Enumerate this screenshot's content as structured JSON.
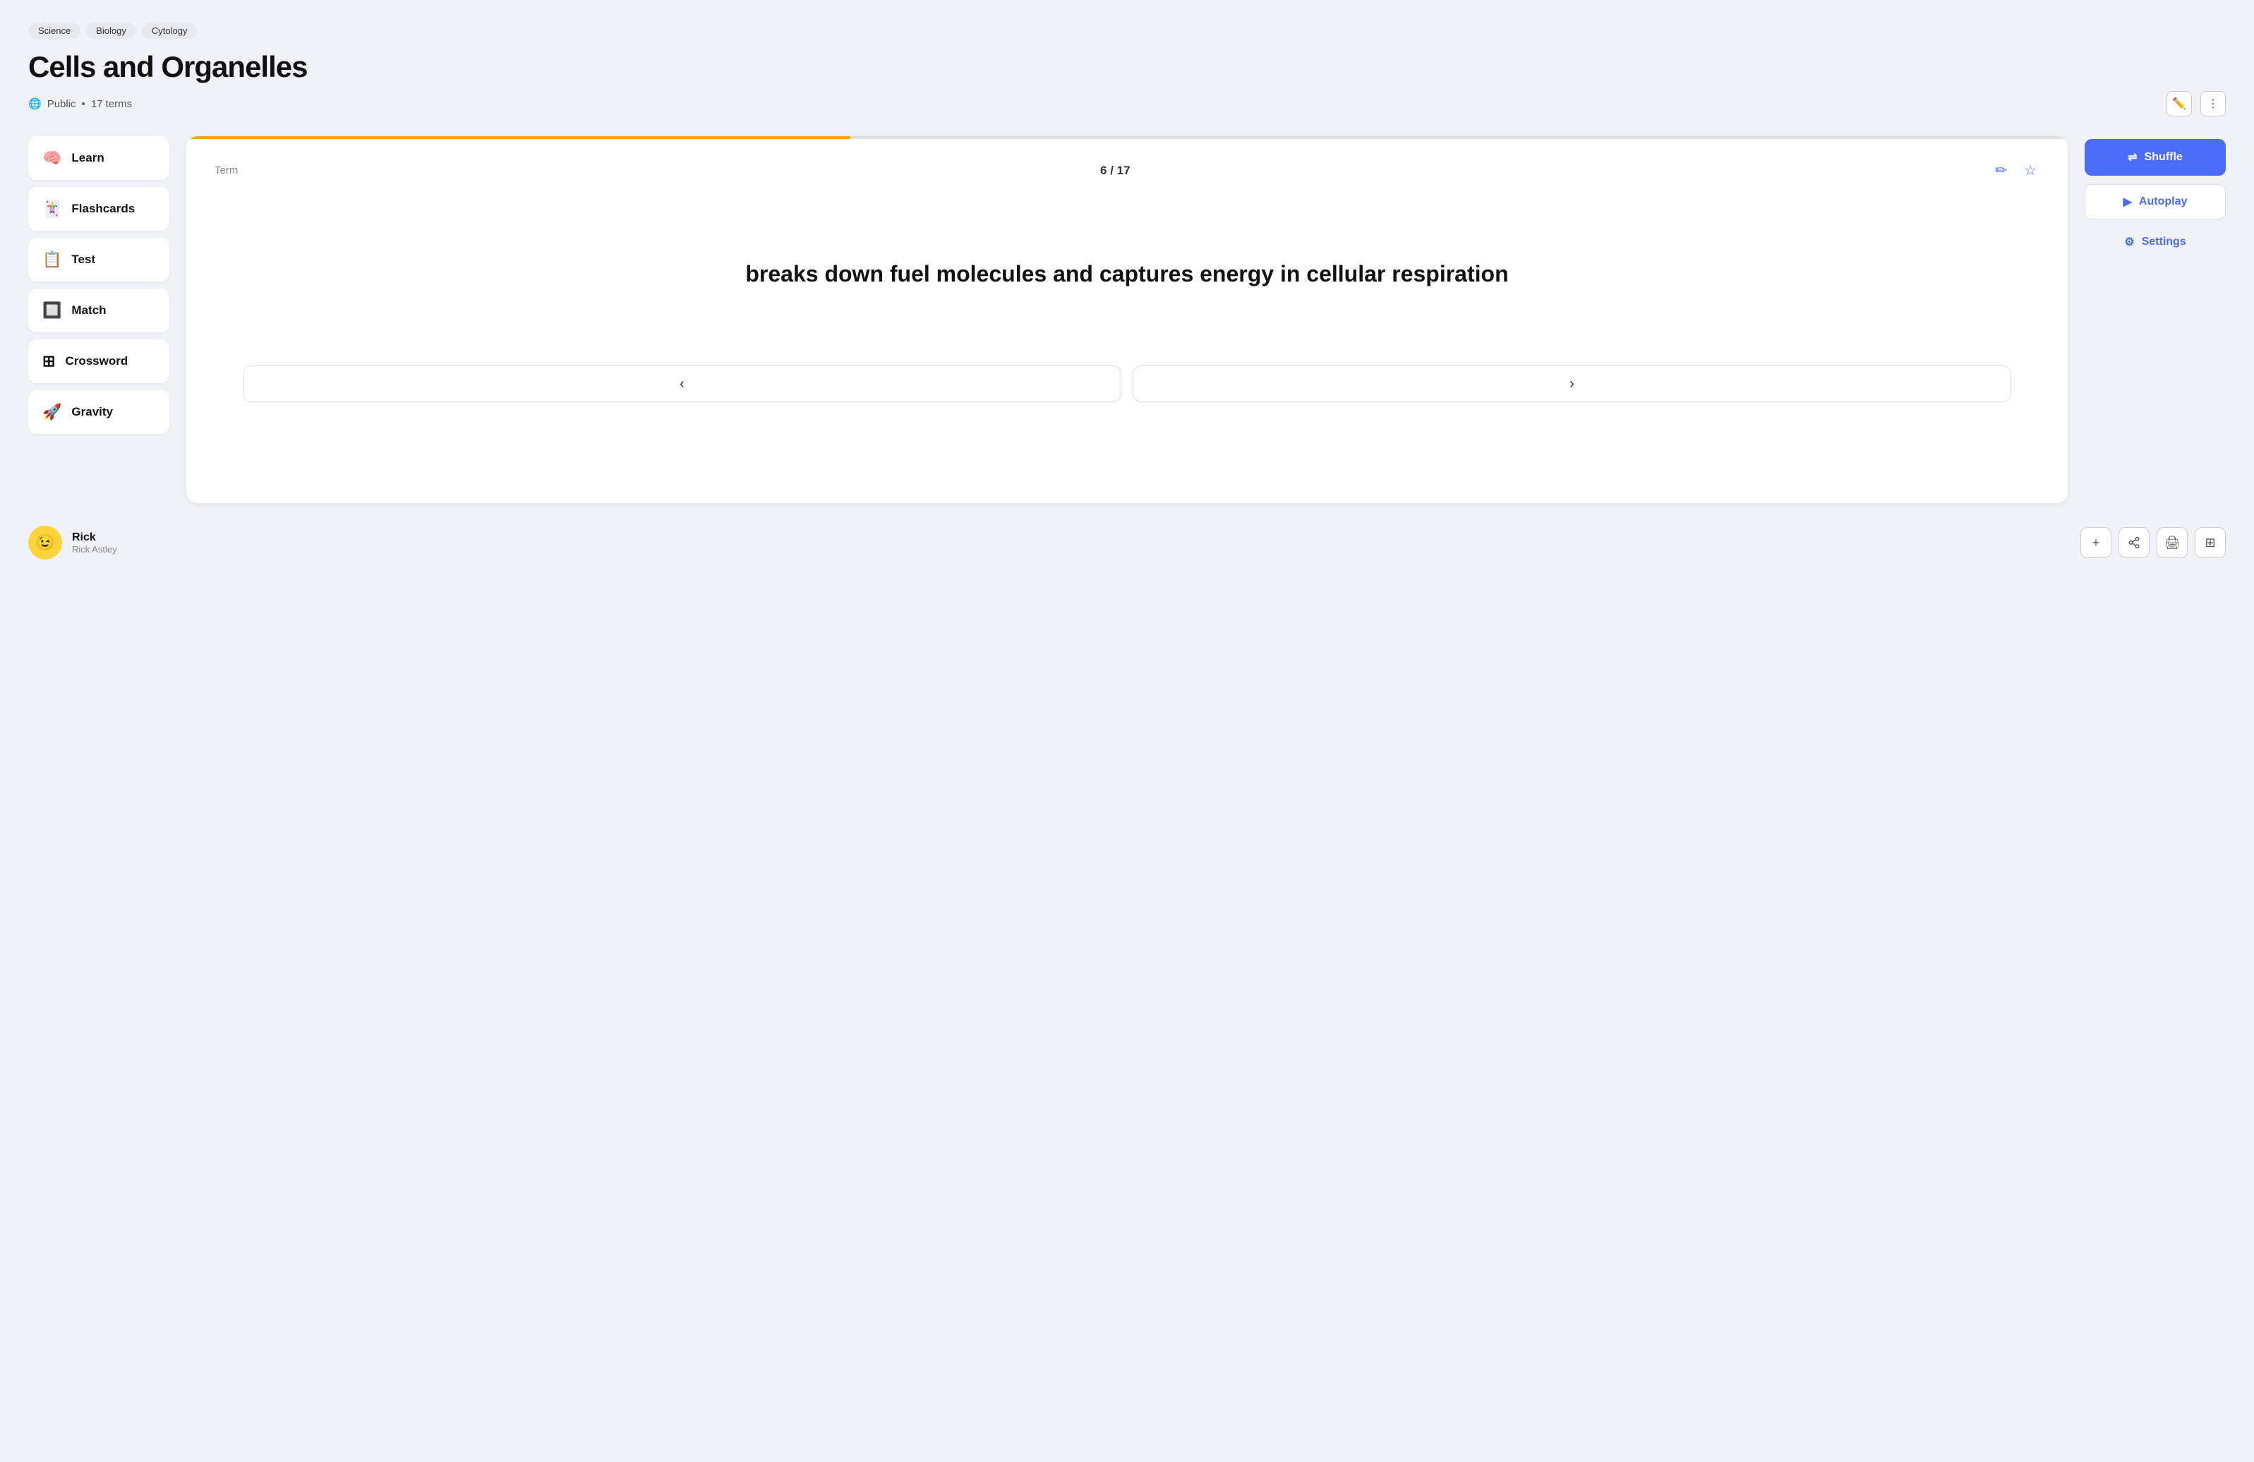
{
  "breadcrumbs": [
    "Science",
    "Biology",
    "Cytology"
  ],
  "title": "Cells and Organelles",
  "meta": {
    "visibility": "Public",
    "terms": "17 terms",
    "dot": "•"
  },
  "sidebar": {
    "items": [
      {
        "id": "learn",
        "label": "Learn",
        "icon": "🧠"
      },
      {
        "id": "flashcards",
        "label": "Flashcards",
        "icon": "🃏"
      },
      {
        "id": "test",
        "label": "Test",
        "icon": "📋"
      },
      {
        "id": "match",
        "label": "Match",
        "icon": "🔲"
      },
      {
        "id": "crossword",
        "label": "Crossword",
        "icon": "⊞"
      },
      {
        "id": "gravity",
        "label": "Gravity",
        "icon": "🚀"
      }
    ]
  },
  "flashcard": {
    "label": "Term",
    "current": 6,
    "total": 17,
    "counter_text": "6 / 17",
    "content": "breaks down fuel molecules and captures energy in cellular respiration",
    "progress_percent": 35.3
  },
  "controls": {
    "shuffle_label": "Shuffle",
    "autoplay_label": "Autoplay",
    "settings_label": "Settings"
  },
  "nav": {
    "prev": "‹",
    "next": "›"
  },
  "user": {
    "name": "Rick",
    "handle": "Rick Astley",
    "avatar_emoji": "😉"
  },
  "bottom_actions": [
    {
      "id": "add",
      "icon": "+"
    },
    {
      "id": "share",
      "icon": "⇧"
    },
    {
      "id": "print",
      "icon": "🖨"
    },
    {
      "id": "grid",
      "icon": "⊞"
    }
  ],
  "icons": {
    "globe": "🌐",
    "edit": "✏️",
    "more": "⋮",
    "pencil": "✏",
    "star": "☆",
    "shuffle": "⇌",
    "play": "▶",
    "gear": "⚙"
  }
}
